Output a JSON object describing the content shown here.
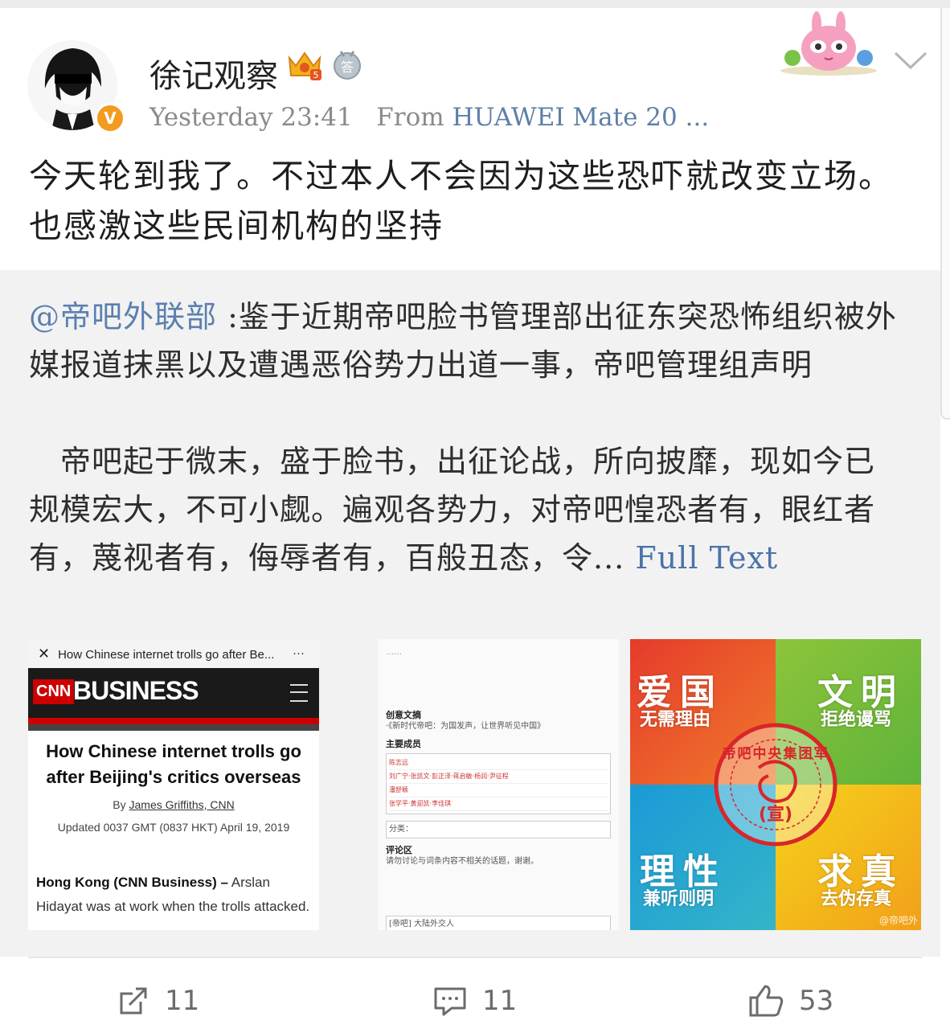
{
  "post": {
    "username": "徐记观察",
    "time": "Yesterday 23:41",
    "source_prefix": "From",
    "device": "HUAWEI Mate 20 ...",
    "text": "今天轮到我了。不过本人不会因为这些恐吓就改变立场。也感激这些民间机构的坚持"
  },
  "repost": {
    "mention": "@帝吧外联部",
    "text": " :鉴于近期帝吧脸书管理部出征东突恐怖组织被外媒报道抹黑以及遭遇恶俗势力出道一事，帝吧管理组声明",
    "para2": "　帝吧起于微末，盛于脸书，出征论战，所向披靡，现如今已规模宏大，不可小觑。遍观各势力，对帝吧惶恐者有，眼红者有，蔑视者有，侮辱者有，百般丑态，令...",
    "full_text_label": "Full Text"
  },
  "thumb_cnn": {
    "topbar_text": "How Chinese internet trolls go after Be...",
    "close": "✕",
    "more": "···",
    "logo": "CNN",
    "section": "BUSINESS",
    "headline": "How Chinese internet trolls go after Beijing's critics overseas",
    "by_prefix": "By",
    "author": "James Griffiths, CNN",
    "updated": "Updated 0037 GMT (0837 HKT) April 19, 2019",
    "lede_bold": "Hong Kong (CNN Business) –",
    "lede": " Arslan Hidayat was at work when the trolls attacked."
  },
  "thumb_wiki": {
    "intro": "……",
    "section1": "创意文摘",
    "item1": "·《新时代帝吧：为国发声，让世界听见中国》",
    "section2": "主要成员",
    "rows": [
      "陈志远",
      "刘广宁·张凯文·彭正泽·蒋启敏·杨润·尹征程",
      "潘舒颖",
      "张学平·黄迎凯·李佳琪"
    ],
    "category": "分类：",
    "section3": "评论区",
    "comment_note": "请勿讨论与词条内容不相关的话题，谢谢。",
    "footer": "[帝吧] 大陆外交人"
  },
  "thumb_poster": {
    "q1_big": "爱国",
    "q1_small": "无需理由",
    "q2_big": "文明",
    "q2_small": "拒绝谩骂",
    "q3_big": "理性",
    "q3_small": "兼听则明",
    "q4_big": "求真",
    "q4_small": "去伪存真",
    "seal_text": "帝吧中央集团军",
    "seal_center": "(宣)",
    "watermark": "@帝吧外"
  },
  "actions": {
    "repost_count": "11",
    "comment_count": "11",
    "like_count": "53"
  },
  "colors": {
    "link": "#5b7fb0",
    "verified": "#f39b1f",
    "repost_bg": "#f2f2f2"
  }
}
